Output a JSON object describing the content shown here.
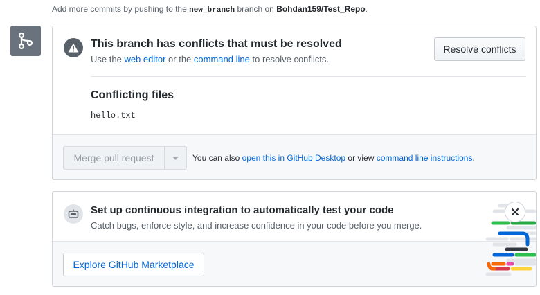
{
  "top_note": {
    "prefix": "Add more commits by pushing to the",
    "branch": "new_branch",
    "middle": "branch on",
    "repo": "Bohdan159/Test_Repo",
    "suffix": "."
  },
  "conflict": {
    "title": "This branch has conflicts that must be resolved",
    "sub_prefix": "Use the",
    "web_editor_link": "web editor",
    "sub_or": "or the",
    "command_line_link": "command line",
    "sub_suffix": "to resolve conflicts.",
    "resolve_button": "Resolve conflicts",
    "files_title": "Conflicting files",
    "files": [
      "hello.txt"
    ]
  },
  "merge": {
    "button_label": "Merge pull request",
    "text_prefix": "You can also",
    "desktop_link": "open this in GitHub Desktop",
    "text_or": "or view",
    "instructions_link": "command line instructions",
    "text_suffix": "."
  },
  "ci": {
    "title": "Set up continuous integration to automatically test your code",
    "subtitle": "Catch bugs, enforce style, and increase confidence in your code before you merge.",
    "marketplace_button": "Explore GitHub Marketplace"
  },
  "icons": {
    "merge": "git-merge-icon",
    "warning": "alert-icon",
    "dropdown": "triangle-down-icon",
    "ci": "ci-robot-icon",
    "close": "close-icon"
  },
  "colors": {
    "link": "#0366d6",
    "icon_gray": "#6a737d",
    "disabled_text": "#959da5"
  }
}
